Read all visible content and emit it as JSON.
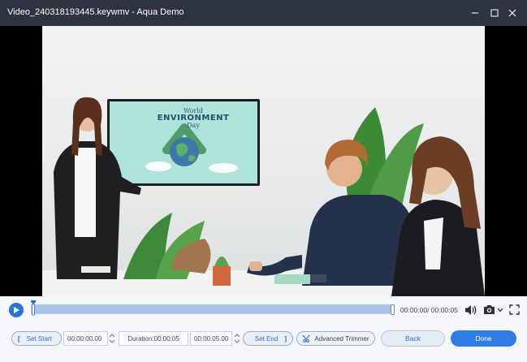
{
  "window": {
    "title": "Video_240318193445.keywmv - Aqua Demo"
  },
  "video": {
    "tv_title_line1": "World",
    "tv_title_line2": "ENVIRONMENT",
    "tv_title_line3": "Day"
  },
  "playback": {
    "time_readout": "00:00:00/ 00:00:05",
    "progress_fraction": 1.0
  },
  "trim": {
    "set_start_label": "Set Start",
    "start_time": "00:00:00.00",
    "duration_label": "Duration:00:00:05",
    "end_time": "00:00:05.00",
    "set_end_label": "Set End",
    "advanced_trimmer_label": "Advanced Trimmer"
  },
  "actions": {
    "back_label": "Back",
    "done_label": "Done"
  },
  "colors": {
    "titlebar": "#2d3340",
    "accent": "#2e7de6",
    "timeline_fill": "#a9c4ec"
  },
  "icons": {
    "minimize": "minimize-icon",
    "maximize": "maximize-icon",
    "close": "close-icon",
    "play": "play-icon",
    "volume": "volume-icon",
    "snapshot": "camera-icon",
    "fullscreen": "fullscreen-icon",
    "advanced_trimmer": "trimmer-icon"
  }
}
